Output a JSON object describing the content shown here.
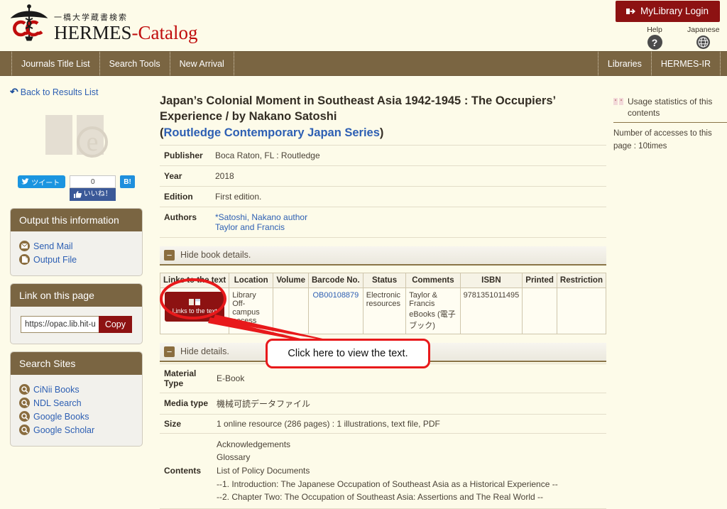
{
  "header": {
    "logo_jp": "一橋大学蔵書検索",
    "logo_hermes": "HERMES",
    "logo_dash": "-",
    "logo_catalog": "Catalog",
    "login_label": "MyLibrary Login",
    "help_label": "Help",
    "help_glyph": "?",
    "japanese_label": "Japanese"
  },
  "nav": {
    "left": [
      "Journals Title List",
      "Search Tools",
      "New Arrival"
    ],
    "right": [
      "Libraries",
      "HERMES-IR"
    ]
  },
  "sidebar": {
    "back_label": "Back to Results List",
    "cover_letter": "e",
    "social": {
      "tweet_label": "ツイート",
      "fb_count": "0",
      "fb_like_label": "いいね！",
      "hatena_label": "B!"
    },
    "output_panel": {
      "title": "Output this information",
      "items": [
        {
          "label": "Send Mail",
          "icon": "mail-icon"
        },
        {
          "label": "Output File",
          "icon": "file-icon"
        }
      ]
    },
    "link_panel": {
      "title": "Link on this page",
      "url_value": "https://opac.lib.hit-u",
      "copy_label": "Copy"
    },
    "search_panel": {
      "title": "Search Sites",
      "items": [
        "CiNii Books",
        "NDL Search",
        "Google Books",
        "Google Scholar"
      ]
    }
  },
  "record": {
    "title_line1": "Japan’s Colonial Moment in Southeast Asia 1942-1945 : The Occupiers’",
    "title_line2": "Experience / by Nakano Satoshi",
    "series_open": "(",
    "series": "Routledge Contemporary Japan Series",
    "series_close": ")",
    "meta": [
      {
        "key": "Publisher",
        "value": "Boca Raton, FL : Routledge"
      },
      {
        "key": "Year",
        "value": "2018"
      },
      {
        "key": "Edition",
        "value": "First edition."
      }
    ],
    "authors_key": "Authors",
    "authors": [
      "*Satoshi, Nakano author",
      "Taylor and Francis"
    ],
    "hide_book_details_label": "Hide book details.",
    "hide_details_label": "Hide details.",
    "holdings": {
      "headers": [
        "Links to the text",
        "Location",
        "Volume",
        "Barcode No.",
        "Status",
        "Comments",
        "ISBN",
        "Printed",
        "Restriction"
      ],
      "row": {
        "button_label": "Links to the text",
        "location": "Library Off-campus access",
        "volume": "",
        "barcode": "OB00108879",
        "status": "Electronic resources",
        "comments": "Taylor & Francis eBooks (電子ブック)",
        "isbn": "9781351011495",
        "printed": "",
        "restriction": ""
      }
    },
    "details": [
      {
        "key": "Material Type",
        "value": "E-Book"
      },
      {
        "key": "Media type",
        "value": "機械可読データファイル"
      },
      {
        "key": "Size",
        "value": "1 online resource (286 pages) : 1 illustrations, text file, PDF"
      }
    ],
    "contents_key": "Contents",
    "contents": [
      "Acknowledgements",
      "Glossary",
      "List of Policy Documents",
      "--1. Introduction: The Japanese Occupation of Southeast Asia as a Historical Experience --",
      "--2. Chapter Two: The Occupation of Southeast Asia: Assertions and The Real World --"
    ]
  },
  "usage": {
    "title": "Usage statistics of this contents",
    "body": "Number of accesses to this page : 10times"
  },
  "annotation": {
    "callout_text": "Click here to view the text."
  },
  "colors": {
    "brand_brown": "#7a6542",
    "brand_red": "#8d1212",
    "link_blue": "#2d5fb3",
    "page_bg": "#fdfbe9",
    "annotation_red": "#e8191b"
  }
}
